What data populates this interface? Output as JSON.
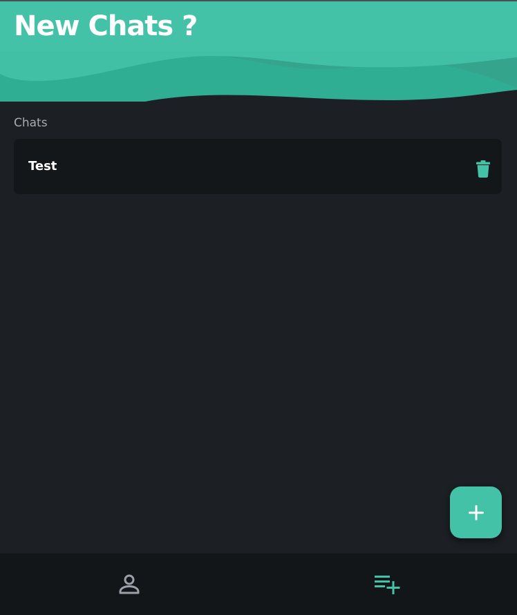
{
  "header": {
    "title": "New Chats ?"
  },
  "chats": {
    "section_label": "Chats",
    "items": [
      {
        "name": "Test",
        "action_icon": "trash-icon"
      }
    ]
  },
  "fab": {
    "icon": "plus-icon"
  },
  "bottom_nav": {
    "items": [
      {
        "icon": "person-icon",
        "active": false
      },
      {
        "icon": "playlist-add-icon",
        "active": true
      }
    ]
  },
  "colors": {
    "accent": "#44c2a8",
    "background": "#1c1f23",
    "card": "#141719",
    "nav_background": "#131619",
    "muted_text": "#a6adb5",
    "inactive_icon": "#9aa1a8"
  }
}
